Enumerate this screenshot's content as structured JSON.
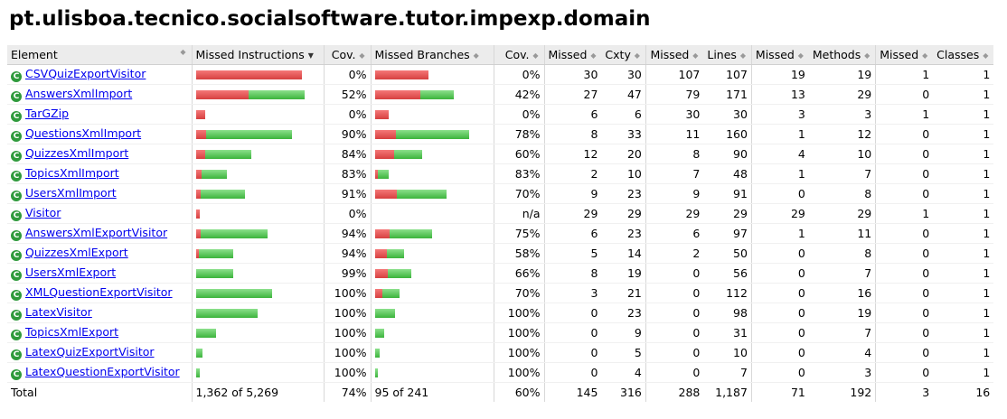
{
  "title": "pt.ulisboa.tecnico.socialsoftware.tutor.impexp.domain",
  "headers": {
    "element": "Element",
    "missed_instructions": "Missed Instructions",
    "cov1": "Cov.",
    "missed_branches": "Missed Branches",
    "cov2": "Cov.",
    "missed_cxty": "Missed",
    "cxty": "Cxty",
    "missed_lines": "Missed",
    "lines": "Lines",
    "missed_methods": "Missed",
    "methods": "Methods",
    "missed_classes": "Missed",
    "classes": "Classes"
  },
  "icons": {
    "class_icon": "class-c-icon",
    "sort_icon": "sort-arrows-icon",
    "sort_desc_icon": "sort-desc-icon"
  },
  "colors": {
    "missed": "#d64040",
    "covered": "#3cb43c",
    "class_icon": "#2f9a3c"
  },
  "rows": [
    {
      "name": "CSVQuizExportVisitor",
      "ins_missed_frac": 1.0,
      "ins_covered_frac": 0.0,
      "ins_cov": "0%",
      "br_missed_frac": 1.0,
      "br_covered_frac": 0.0,
      "br_cov": "0%",
      "cxty_missed": "30",
      "cxty": "30",
      "lines_missed": "107",
      "lines": "107",
      "methods_missed": "19",
      "methods": "19",
      "classes_missed": "1",
      "classes": "1"
    },
    {
      "name": "AnswersXmlImport",
      "ins_missed_frac": 0.48,
      "ins_covered_frac": 0.52,
      "ins_cov": "52%",
      "br_missed_frac": 0.58,
      "br_covered_frac": 0.42,
      "br_cov": "42%",
      "cxty_missed": "27",
      "cxty": "47",
      "lines_missed": "79",
      "lines": "171",
      "methods_missed": "13",
      "methods": "29",
      "classes_missed": "0",
      "classes": "1"
    },
    {
      "name": "TarGZip",
      "ins_missed_frac": 1.0,
      "ins_covered_frac": 0.0,
      "ins_cov": "0%",
      "br_missed_frac": 1.0,
      "br_covered_frac": 0.0,
      "br_cov": "0%",
      "cxty_missed": "6",
      "cxty": "6",
      "lines_missed": "30",
      "lines": "30",
      "methods_missed": "3",
      "methods": "3",
      "classes_missed": "1",
      "classes": "1"
    },
    {
      "name": "QuestionsXmlImport",
      "ins_missed_frac": 0.1,
      "ins_covered_frac": 0.9,
      "ins_cov": "90%",
      "br_missed_frac": 0.22,
      "br_covered_frac": 0.78,
      "br_cov": "78%",
      "cxty_missed": "8",
      "cxty": "33",
      "lines_missed": "11",
      "lines": "160",
      "methods_missed": "1",
      "methods": "12",
      "classes_missed": "0",
      "classes": "1"
    },
    {
      "name": "QuizzesXmlImport",
      "ins_missed_frac": 0.16,
      "ins_covered_frac": 0.84,
      "ins_cov": "84%",
      "br_missed_frac": 0.4,
      "br_covered_frac": 0.6,
      "br_cov": "60%",
      "cxty_missed": "12",
      "cxty": "20",
      "lines_missed": "8",
      "lines": "90",
      "methods_missed": "4",
      "methods": "10",
      "classes_missed": "0",
      "classes": "1"
    },
    {
      "name": "TopicsXmlImport",
      "ins_missed_frac": 0.17,
      "ins_covered_frac": 0.83,
      "ins_cov": "83%",
      "br_missed_frac": 0.17,
      "br_covered_frac": 0.83,
      "br_cov": "83%",
      "cxty_missed": "2",
      "cxty": "10",
      "lines_missed": "7",
      "lines": "48",
      "methods_missed": "1",
      "methods": "7",
      "classes_missed": "0",
      "classes": "1"
    },
    {
      "name": "UsersXmlImport",
      "ins_missed_frac": 0.09,
      "ins_covered_frac": 0.91,
      "ins_cov": "91%",
      "br_missed_frac": 0.3,
      "br_covered_frac": 0.7,
      "br_cov": "70%",
      "cxty_missed": "9",
      "cxty": "23",
      "lines_missed": "9",
      "lines": "91",
      "methods_missed": "0",
      "methods": "8",
      "classes_missed": "0",
      "classes": "1"
    },
    {
      "name": "Visitor",
      "ins_missed_frac": 1.0,
      "ins_covered_frac": 0.0,
      "ins_cov": "0%",
      "br_missed_frac": 0.0,
      "br_covered_frac": 0.0,
      "br_cov": "n/a",
      "cxty_missed": "29",
      "cxty": "29",
      "lines_missed": "29",
      "lines": "29",
      "methods_missed": "29",
      "methods": "29",
      "classes_missed": "1",
      "classes": "1"
    },
    {
      "name": "AnswersXmlExportVisitor",
      "ins_missed_frac": 0.06,
      "ins_covered_frac": 0.94,
      "ins_cov": "94%",
      "br_missed_frac": 0.25,
      "br_covered_frac": 0.75,
      "br_cov": "75%",
      "cxty_missed": "6",
      "cxty": "23",
      "lines_missed": "6",
      "lines": "97",
      "methods_missed": "1",
      "methods": "11",
      "classes_missed": "0",
      "classes": "1"
    },
    {
      "name": "QuizzesXmlExport",
      "ins_missed_frac": 0.06,
      "ins_covered_frac": 0.94,
      "ins_cov": "94%",
      "br_missed_frac": 0.42,
      "br_covered_frac": 0.58,
      "br_cov": "58%",
      "cxty_missed": "5",
      "cxty": "14",
      "lines_missed": "2",
      "lines": "50",
      "methods_missed": "0",
      "methods": "8",
      "classes_missed": "0",
      "classes": "1"
    },
    {
      "name": "UsersXmlExport",
      "ins_missed_frac": 0.01,
      "ins_covered_frac": 0.99,
      "ins_cov": "99%",
      "br_missed_frac": 0.34,
      "br_covered_frac": 0.66,
      "br_cov": "66%",
      "cxty_missed": "8",
      "cxty": "19",
      "lines_missed": "0",
      "lines": "56",
      "methods_missed": "0",
      "methods": "7",
      "classes_missed": "0",
      "classes": "1"
    },
    {
      "name": "XMLQuestionExportVisitor",
      "ins_missed_frac": 0.0,
      "ins_covered_frac": 1.0,
      "ins_cov": "100%",
      "br_missed_frac": 0.3,
      "br_covered_frac": 0.7,
      "br_cov": "70%",
      "cxty_missed": "3",
      "cxty": "21",
      "lines_missed": "0",
      "lines": "112",
      "methods_missed": "0",
      "methods": "16",
      "classes_missed": "0",
      "classes": "1"
    },
    {
      "name": "LatexVisitor",
      "ins_missed_frac": 0.0,
      "ins_covered_frac": 1.0,
      "ins_cov": "100%",
      "br_missed_frac": 0.0,
      "br_covered_frac": 1.0,
      "br_cov": "100%",
      "cxty_missed": "0",
      "cxty": "23",
      "lines_missed": "0",
      "lines": "98",
      "methods_missed": "0",
      "methods": "19",
      "classes_missed": "0",
      "classes": "1"
    },
    {
      "name": "TopicsXmlExport",
      "ins_missed_frac": 0.0,
      "ins_covered_frac": 1.0,
      "ins_cov": "100%",
      "br_missed_frac": 0.0,
      "br_covered_frac": 1.0,
      "br_cov": "100%",
      "cxty_missed": "0",
      "cxty": "9",
      "lines_missed": "0",
      "lines": "31",
      "methods_missed": "0",
      "methods": "7",
      "classes_missed": "0",
      "classes": "1"
    },
    {
      "name": "LatexQuizExportVisitor",
      "ins_missed_frac": 0.0,
      "ins_covered_frac": 1.0,
      "ins_cov": "100%",
      "br_missed_frac": 0.0,
      "br_covered_frac": 1.0,
      "br_cov": "100%",
      "cxty_missed": "0",
      "cxty": "5",
      "lines_missed": "0",
      "lines": "10",
      "methods_missed": "0",
      "methods": "4",
      "classes_missed": "0",
      "classes": "1"
    },
    {
      "name": "LatexQuestionExportVisitor",
      "ins_missed_frac": 0.0,
      "ins_covered_frac": 1.0,
      "ins_cov": "100%",
      "br_missed_frac": 0.0,
      "br_covered_frac": 1.0,
      "br_cov": "100%",
      "cxty_missed": "0",
      "cxty": "4",
      "lines_missed": "0",
      "lines": "7",
      "methods_missed": "0",
      "methods": "3",
      "classes_missed": "0",
      "classes": "1"
    }
  ],
  "bar_scale": {
    "instructions_total": [
      1095,
      1124,
      95,
      981,
      575,
      316,
      505,
      40,
      739,
      379,
      386,
      788,
      636,
      203,
      61,
      33
    ],
    "branches_total": [
      70,
      104,
      18,
      124,
      62,
      18,
      94,
      0,
      74,
      38,
      48,
      32,
      26,
      12,
      6,
      4
    ]
  },
  "total": {
    "label": "Total",
    "ins": "1,362 of 5,269",
    "ins_cov": "74%",
    "br": "95 of 241",
    "br_cov": "60%",
    "cxty_missed": "145",
    "cxty": "316",
    "lines_missed": "288",
    "lines": "1,187",
    "methods_missed": "71",
    "methods": "192",
    "classes_missed": "3",
    "classes": "16"
  }
}
